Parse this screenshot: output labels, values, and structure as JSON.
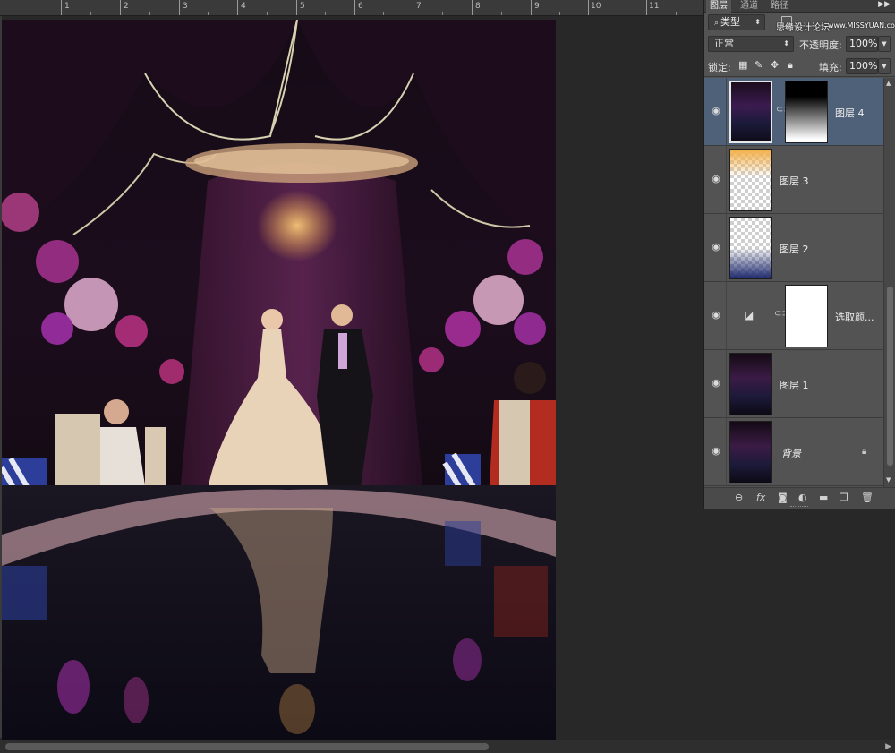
{
  "ruler": {
    "labels": [
      "1",
      "2",
      "3",
      "4",
      "5",
      "6",
      "7",
      "8",
      "9",
      "10",
      "11"
    ]
  },
  "panel": {
    "tabs": [
      "图层",
      "通道",
      "路径"
    ],
    "collapse_icon": "double-right-arrow",
    "filter_kind": "类型",
    "watermark": "思缘设计论坛",
    "watermark_url": "www.MISSYUAN.com",
    "blend_mode": "正常",
    "opacity_label": "不透明度:",
    "opacity_value": "100%",
    "lock_label": "锁定:",
    "fill_label": "填充:",
    "fill_value": "100%"
  },
  "layers": [
    {
      "name": "图层 4",
      "selected": true,
      "has_mask": true
    },
    {
      "name": "图层 3",
      "selected": false,
      "has_mask": false
    },
    {
      "name": "图层 2",
      "selected": false,
      "has_mask": false
    },
    {
      "name": "选取颜...",
      "selected": false,
      "has_mask": true
    },
    {
      "name": "图层 1",
      "selected": false,
      "has_mask": false
    },
    {
      "name": "背景",
      "selected": false,
      "locked": true
    }
  ],
  "bottom_icons": [
    "link-icon",
    "fx-icon",
    "mask-icon",
    "adjustment-icon",
    "folder-icon",
    "new-layer-icon",
    "trash-icon"
  ],
  "colors": {
    "panel_bg": "#535353",
    "selected_row": "#4f6178",
    "canvas_bg": "#282828"
  }
}
